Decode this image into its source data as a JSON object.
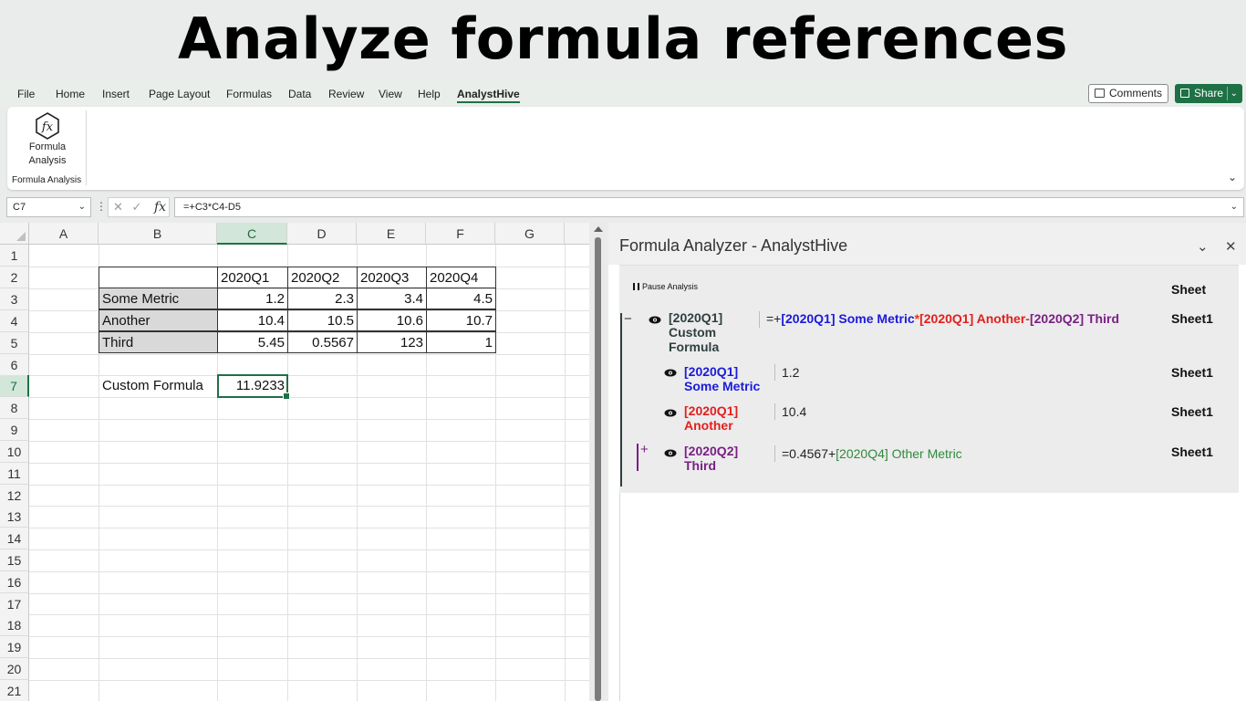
{
  "banner": {
    "title": "Analyze formula references"
  },
  "menu": {
    "items": [
      "File",
      "Home",
      "Insert",
      "Page Layout",
      "Formulas",
      "Data",
      "Review",
      "View",
      "Help",
      "AnalystHive"
    ],
    "comments_label": "Comments",
    "share_label": "Share"
  },
  "ribbon": {
    "button_label_1": "Formula",
    "button_label_2": "Analysis",
    "group_label": "Formula Analysis"
  },
  "formula_bar": {
    "name_box": "C7",
    "fx_symbol": "fx",
    "formula": "=+C3*C4-D5"
  },
  "sheet": {
    "columns": [
      "A",
      "B",
      "C",
      "D",
      "E",
      "F",
      "G"
    ],
    "rows": [
      "1",
      "2",
      "3",
      "4",
      "5",
      "6",
      "7",
      "8",
      "9",
      "10",
      "11",
      "12",
      "13",
      "14",
      "15",
      "16",
      "17",
      "18",
      "19",
      "20",
      "21"
    ],
    "header_row": [
      "2020Q1",
      "2020Q2",
      "2020Q3",
      "2020Q4"
    ],
    "table": [
      {
        "label": "Some Metric",
        "values": [
          "1.2",
          "2.3",
          "3.4",
          "4.5"
        ]
      },
      {
        "label": "Another",
        "values": [
          "10.4",
          "10.5",
          "10.6",
          "10.7"
        ]
      },
      {
        "label": "Third",
        "values": [
          "5.45",
          "0.5567",
          "123",
          "1"
        ]
      }
    ],
    "custom_label": "Custom Formula",
    "custom_value": "11.9233",
    "active_cell": "C7"
  },
  "pane": {
    "title": "Formula Analyzer - AnalystHive",
    "pause_label": "Pause Analysis",
    "sheet_header": "Sheet",
    "root": {
      "toggle": "−",
      "label_line1": "[2020Q1]",
      "label_line2": "Custom",
      "label_line3": "Formula",
      "formula_prefix": "=+",
      "ref1": "[2020Q1] Some Metric",
      "op1": "*",
      "ref2": "[2020Q1] Another",
      "op2": "-",
      "ref3": "[2020Q2] Third",
      "sheet": "Sheet1"
    },
    "children": [
      {
        "line1": "[2020Q1]",
        "line2": "Some Metric",
        "value": "1.2",
        "sheet": "Sheet1"
      },
      {
        "line1": "[2020Q1]",
        "line2": "Another",
        "value": "10.4",
        "sheet": "Sheet1"
      },
      {
        "toggle": "+",
        "line1": "[2020Q2]",
        "line2": "Third",
        "value_prefix": "=0.4567+",
        "value_ref": "[2020Q4] Other Metric",
        "sheet": "Sheet1"
      }
    ]
  },
  "colors": {
    "accent": "#1e7145",
    "ref_blue": "#1a1adc",
    "ref_red": "#e0201f",
    "ref_purple": "#7a1f86",
    "ref_green": "#2e8b3a"
  }
}
